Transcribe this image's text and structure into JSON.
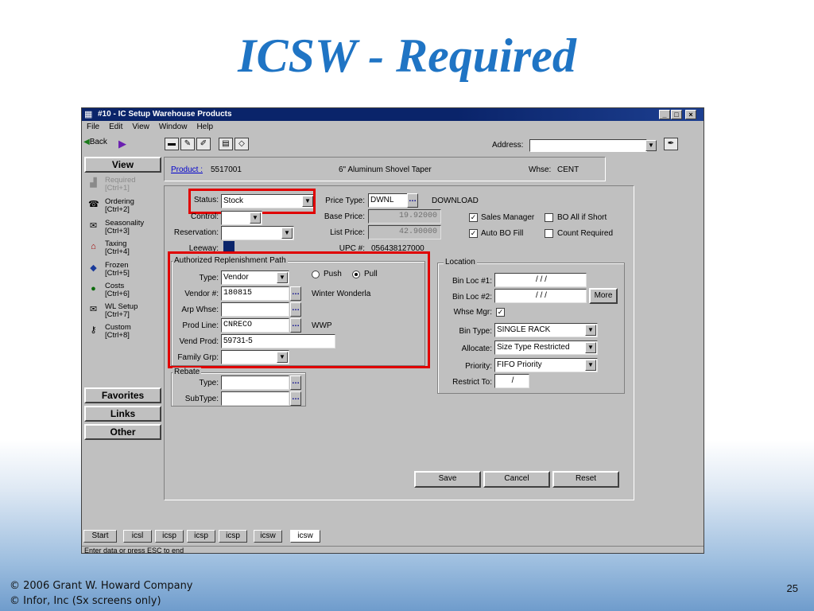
{
  "slide": {
    "title": "ICSW - Required",
    "footer_line1": "©  2006 Grant W. Howard Company",
    "footer_line2": "©  Infor, Inc (Sx screens only)",
    "page_number": "25"
  },
  "window": {
    "title": "#10 - IC Setup Warehouse Products",
    "menu": [
      "File",
      "Edit",
      "View",
      "Window",
      "Help"
    ],
    "toolbar": {
      "back_label": "Back",
      "address_label": "Address:",
      "address_value": ""
    }
  },
  "nav": {
    "view_label": "View",
    "items": [
      {
        "label": "Required",
        "shortcut": "[Ctrl+1]",
        "icon": "required-icon"
      },
      {
        "label": "Ordering",
        "shortcut": "[Ctrl+2]",
        "icon": "telephone-icon"
      },
      {
        "label": "Seasonality",
        "shortcut": "[Ctrl+3]",
        "icon": "envelope-icon"
      },
      {
        "label": "Taxing",
        "shortcut": "[Ctrl+4]",
        "icon": "taxing-icon"
      },
      {
        "label": "Frozen",
        "shortcut": "[Ctrl+5]",
        "icon": "car-icon"
      },
      {
        "label": "Costs",
        "shortcut": "[Ctrl+6]",
        "icon": "costs-icon"
      },
      {
        "label": "WL Setup",
        "shortcut": "[Ctrl+7]",
        "icon": "envelope-icon"
      },
      {
        "label": "Custom",
        "shortcut": "[Ctrl+8]",
        "icon": "key-icon"
      }
    ],
    "favorites_label": "Favorites",
    "links_label": "Links",
    "other_label": "Other"
  },
  "header": {
    "product_label": "Product :",
    "product_value": "5517001",
    "description": "6\" Aluminum Shovel Taper",
    "whse_label": "Whse:",
    "whse_value": "CENT"
  },
  "form": {
    "status_label": "Status:",
    "status_value": "Stock",
    "control_label": "Control:",
    "control_value": "",
    "reservation_label": "Reservation:",
    "reservation_value": "",
    "leeway_label": "Leeway:",
    "price_type_label": "Price Type:",
    "price_type_value": "DWNL",
    "price_type_desc": "DOWNLOAD",
    "base_price_label": "Base Price:",
    "base_price_value": "19.92000",
    "list_price_label": "List Price:",
    "list_price_value": "42.90000",
    "upc_label": "UPC #:",
    "upc_value": "056438127000",
    "sales_manager_label": "Sales Manager",
    "bo_all_if_short_label": "BO All if Short",
    "auto_bo_fill_label": "Auto BO Fill",
    "count_required_label": "Count Required",
    "replenishment": {
      "title": "Authorized Replenishment Path",
      "type_label": "Type:",
      "type_value": "Vendor",
      "push_label": "Push",
      "pull_label": "Pull",
      "vendor_label": "Vendor #:",
      "vendor_value": "180815",
      "vendor_name": "Winter Wonderla",
      "arp_whse_label": "Arp Whse:",
      "arp_whse_value": "",
      "prod_line_label": "Prod Line:",
      "prod_line_value": "CNRECO",
      "prod_line_desc": "WWP",
      "vend_prod_label": "Vend Prod:",
      "vend_prod_value": "59731-5",
      "family_grp_label": "Family Grp:",
      "family_grp_value": ""
    },
    "rebate": {
      "title": "Rebate",
      "type_label": "Type:",
      "type_value": "",
      "subtype_label": "SubType:",
      "subtype_value": ""
    },
    "location": {
      "title": "Location",
      "bin_loc1_label": "Bin Loc #1:",
      "bin_loc1_value": "/    /    /",
      "bin_loc2_label": "Bin Loc #2:",
      "bin_loc2_value": "/    /    /",
      "more_label": "More",
      "whse_mgr_label": "Whse Mgr:",
      "bin_type_label": "Bin Type:",
      "bin_type_value": "SINGLE RACK",
      "allocate_label": "Allocate:",
      "allocate_value": "Size Type Restricted",
      "priority_label": "Priority:",
      "priority_value": "FIFO Priority",
      "restrict_to_label": "Restrict To:",
      "restrict_to_value": "/"
    },
    "save_label": "Save",
    "cancel_label": "Cancel",
    "reset_label": "Reset"
  },
  "taskbar": [
    "Start",
    "icsl",
    "icsp",
    "icsp",
    "icsp",
    "icsw",
    "icsw"
  ],
  "status_text": "Enter data or press ESC to end",
  "colors": {
    "highlight_box": "#e00000",
    "title_blue": "#1f74c4",
    "titlebar": "#0a246a"
  }
}
